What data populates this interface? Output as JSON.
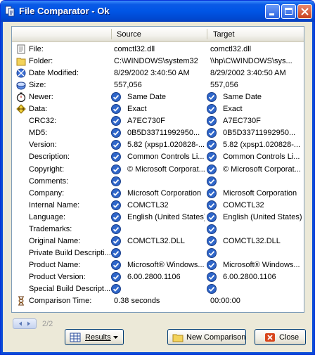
{
  "window": {
    "title": "File Comparator - Ok"
  },
  "columns": {
    "source": "Source",
    "target": "Target"
  },
  "rows": [
    {
      "label": "File:",
      "icon": "file-icon",
      "source": "comctl32.dll",
      "target": "comctl32.dll",
      "check": false
    },
    {
      "label": "Folder:",
      "icon": "folder-icon",
      "source": "C:\\WINDOWS\\system32",
      "target": "\\\\hp\\C\\WINDOWS\\sys...",
      "check": false
    },
    {
      "label": "Date Modified:",
      "icon": "date-icon",
      "source": "8/29/2002 3:40:50 AM",
      "target": "8/29/2002 3:40:50 AM",
      "check": false
    },
    {
      "label": "Size:",
      "icon": "size-icon",
      "source": "557,056",
      "target": "557,056",
      "check": false
    },
    {
      "label": "Newer:",
      "icon": "stopwatch-icon",
      "source": "Same Date",
      "target": "Same Date",
      "check": true
    },
    {
      "label": "Data:",
      "icon": "data-icon",
      "source": "Exact",
      "target": "Exact",
      "check": true
    },
    {
      "label": "CRC32:",
      "icon": "",
      "source": "A7EC730F",
      "target": "A7EC730F",
      "check": true
    },
    {
      "label": "MD5:",
      "icon": "",
      "source": "0B5D33711992950...",
      "target": "0B5D33711992950...",
      "check": true
    },
    {
      "label": "Version:",
      "icon": "",
      "source": "5.82 (xpsp1.020828-...",
      "target": "5.82 (xpsp1.020828-...",
      "check": true
    },
    {
      "label": "Description:",
      "icon": "",
      "source": "Common Controls Li...",
      "target": "Common Controls Li...",
      "check": true
    },
    {
      "label": "Copyright:",
      "icon": "",
      "source": "© Microsoft Corporat...",
      "target": "© Microsoft Corporat...",
      "check": true
    },
    {
      "label": "Comments:",
      "icon": "",
      "source": "",
      "target": "",
      "check": true
    },
    {
      "label": "Company:",
      "icon": "",
      "source": "Microsoft Corporation",
      "target": "Microsoft Corporation",
      "check": true
    },
    {
      "label": "Internal Name:",
      "icon": "",
      "source": "COMCTL32",
      "target": "COMCTL32",
      "check": true
    },
    {
      "label": "Language:",
      "icon": "",
      "source": "English (United States)",
      "target": "English (United States)",
      "check": true
    },
    {
      "label": "Trademarks:",
      "icon": "",
      "source": "",
      "target": "",
      "check": true
    },
    {
      "label": "Original Name:",
      "icon": "",
      "source": "COMCTL32.DLL",
      "target": "COMCTL32.DLL",
      "check": true
    },
    {
      "label": "Private Build Descripti...",
      "icon": "",
      "source": "",
      "target": "",
      "check": true
    },
    {
      "label": "Product Name:",
      "icon": "",
      "source": "Microsoft® Windows...",
      "target": "Microsoft® Windows...",
      "check": true
    },
    {
      "label": "Product Version:",
      "icon": "",
      "source": "6.00.2800.1106",
      "target": "6.00.2800.1106",
      "check": true
    },
    {
      "label": "Special Build Descript...",
      "icon": "",
      "source": "",
      "target": "",
      "check": true
    },
    {
      "label": "Comparison Time:",
      "icon": "hourglass-icon",
      "source": "0.38 seconds",
      "target": "00:00:00",
      "check": false
    }
  ],
  "pager": {
    "text": "2/2"
  },
  "buttons": {
    "results": "Results",
    "new_comparison": "New Comparison",
    "close": "Close"
  },
  "colors": {
    "titlebar": "#0055e5",
    "check": "#2f66c9",
    "window_bg": "#ece9d8"
  }
}
